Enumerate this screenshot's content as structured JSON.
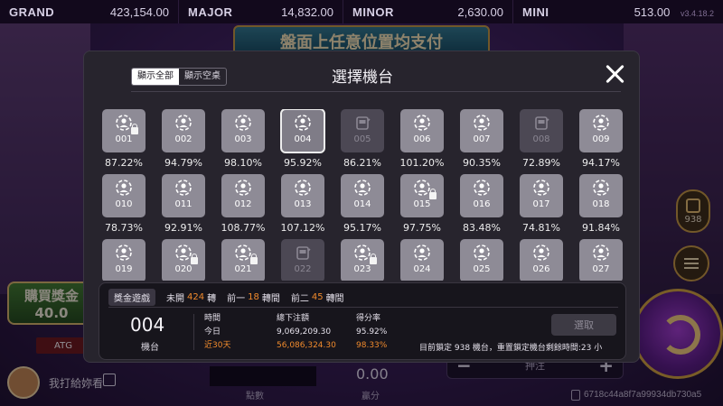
{
  "jackpots": [
    {
      "name": "GRAND",
      "value": "423,154.00"
    },
    {
      "name": "MAJOR",
      "value": "14,832.00"
    },
    {
      "name": "MINOR",
      "value": "2,630.00"
    },
    {
      "name": "MINI",
      "value": "513.00"
    }
  ],
  "version": "v3.4.18.2",
  "banner_text": "盤面上任意位置均支付",
  "ticket_count": "938",
  "buy_bonus": {
    "title": "購買獎金",
    "price": "40.0"
  },
  "brand": "ATG",
  "bet": {
    "minus": "−",
    "plus": "+",
    "label": "押注"
  },
  "user": {
    "name": "我打給妳看"
  },
  "points_label": "點數",
  "win": {
    "value": "0.00",
    "label": "贏分"
  },
  "session_id": "6718c44a8f7a99934db730a5",
  "modal": {
    "filters": {
      "all": "顯示全部",
      "empty": "顯示空桌"
    },
    "title": "選擇機台",
    "machines": [
      {
        "id": "001",
        "rate": "87.22%",
        "locked": true,
        "state": "normal"
      },
      {
        "id": "002",
        "rate": "94.79%",
        "locked": false,
        "state": "normal"
      },
      {
        "id": "003",
        "rate": "98.10%",
        "locked": false,
        "state": "normal"
      },
      {
        "id": "004",
        "rate": "95.92%",
        "locked": false,
        "state": "selected"
      },
      {
        "id": "005",
        "rate": "86.21%",
        "locked": false,
        "state": "disabled"
      },
      {
        "id": "006",
        "rate": "101.20%",
        "locked": false,
        "state": "normal"
      },
      {
        "id": "007",
        "rate": "90.35%",
        "locked": false,
        "state": "normal"
      },
      {
        "id": "008",
        "rate": "72.89%",
        "locked": false,
        "state": "disabled"
      },
      {
        "id": "009",
        "rate": "94.17%",
        "locked": false,
        "state": "normal"
      },
      {
        "id": "010",
        "rate": "78.73%",
        "locked": false,
        "state": "normal"
      },
      {
        "id": "011",
        "rate": "92.91%",
        "locked": false,
        "state": "normal"
      },
      {
        "id": "012",
        "rate": "108.77%",
        "locked": false,
        "state": "normal"
      },
      {
        "id": "013",
        "rate": "107.12%",
        "locked": false,
        "state": "normal"
      },
      {
        "id": "014",
        "rate": "95.17%",
        "locked": false,
        "state": "normal"
      },
      {
        "id": "015",
        "rate": "97.75%",
        "locked": true,
        "state": "normal"
      },
      {
        "id": "016",
        "rate": "83.48%",
        "locked": false,
        "state": "normal"
      },
      {
        "id": "017",
        "rate": "74.81%",
        "locked": false,
        "state": "normal"
      },
      {
        "id": "018",
        "rate": "91.84%",
        "locked": false,
        "state": "normal"
      },
      {
        "id": "019",
        "rate": "",
        "locked": false,
        "state": "normal"
      },
      {
        "id": "020",
        "rate": "",
        "locked": true,
        "state": "normal"
      },
      {
        "id": "021",
        "rate": "",
        "locked": true,
        "state": "normal"
      },
      {
        "id": "022",
        "rate": "",
        "locked": false,
        "state": "disabled"
      },
      {
        "id": "023",
        "rate": "",
        "locked": true,
        "state": "normal"
      },
      {
        "id": "024",
        "rate": "",
        "locked": false,
        "state": "normal"
      },
      {
        "id": "025",
        "rate": "",
        "locked": false,
        "state": "normal"
      },
      {
        "id": "026",
        "rate": "",
        "locked": false,
        "state": "normal"
      },
      {
        "id": "027",
        "rate": "",
        "locked": false,
        "state": "normal"
      }
    ],
    "stats": {
      "tabs": [
        {
          "label": "獎金遊戲",
          "prefix": "",
          "count": "",
          "suffix": ""
        },
        {
          "label": "",
          "prefix": "未開",
          "count": "424",
          "suffix": "轉"
        },
        {
          "label": "",
          "prefix": "前一",
          "count": "18",
          "suffix": "轉間"
        },
        {
          "label": "",
          "prefix": "前二",
          "count": "45",
          "suffix": "轉間"
        }
      ],
      "selected_id": "004",
      "selected_label": "機台",
      "header_time": "時間",
      "header_bet": "總下注額",
      "header_rate": "得分率",
      "today_label": "今日",
      "today_bet": "9,069,209.30",
      "today_rate": "95.92%",
      "days30_label": "近30天",
      "days30_bet": "56,086,324.30",
      "days30_rate": "98.33%",
      "select_button": "選取",
      "lock_info": "目前鎖定 938 機台，重置鎖定機台剩餘時間:23 小"
    }
  },
  "colors": {
    "accent_orange": "#f08a2c",
    "tile_gray": "#8e8b96",
    "modal_bg": "#27242d"
  }
}
